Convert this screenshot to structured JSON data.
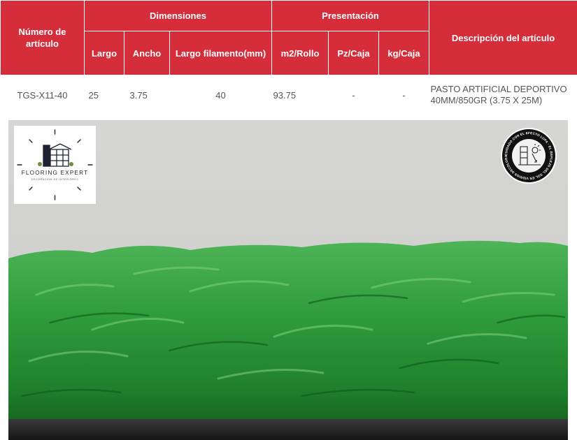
{
  "table": {
    "headers": {
      "item_number": "Número de artículo",
      "dimensions": "Dimensiones",
      "presentation": "Presentación",
      "description": "Descripción del artículo",
      "length": "Largo",
      "width": "Ancho",
      "filament_length": "Largo filamento(mm)",
      "m2_roll": "m2/Rollo",
      "pz_box": "Pz/Caja",
      "kg_box": "kg/Caja"
    },
    "row": {
      "item_number": "TGS-X11-40",
      "length": "25",
      "width": "3.75",
      "filament_length": "40",
      "m2_roll": "93.75",
      "pz_box": "-",
      "kg_box": "-",
      "description": "PASTO ARTIFICIAL DEPORTIVO 40MM/850GR (3.75 X 25M)"
    }
  },
  "logo": {
    "brand": "FLOORING EXPERT",
    "tagline": "DECORACIÓN DE INTERIORES"
  },
  "badge": {
    "text": "CUIDADO CON EL EFECTO LUPA · EL REFLEJO DEL SOL EN VIDRIOS DECOLORA EL PASTO"
  },
  "colors": {
    "header_red": "#d62d3b",
    "grass_green": "#2f9c3c",
    "background_gray": "#d3d3d1"
  }
}
